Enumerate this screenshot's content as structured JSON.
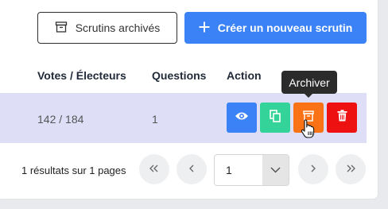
{
  "toolbar": {
    "archived_label": "Scrutins archivés",
    "create_label": "Créer un nouveau scrutin"
  },
  "table": {
    "headers": [
      "Votes / Électeurs",
      "Questions",
      "Action"
    ],
    "rows": [
      {
        "votes": "142 / 184",
        "questions": "1"
      }
    ]
  },
  "actions": {
    "view_icon": "eye-icon",
    "copy_icon": "copy-icon",
    "archive_icon": "archive-box-icon",
    "delete_icon": "trash-icon",
    "tooltip": "Archiver"
  },
  "pagination": {
    "summary": "1 résultats sur 1 pages",
    "page_value": "1"
  },
  "colors": {
    "primary": "#3b82f6",
    "view": "#3b82f6",
    "copy": "#34d399",
    "archive": "#f97316",
    "delete": "#ee1111",
    "selected_row": "#dedff7"
  }
}
